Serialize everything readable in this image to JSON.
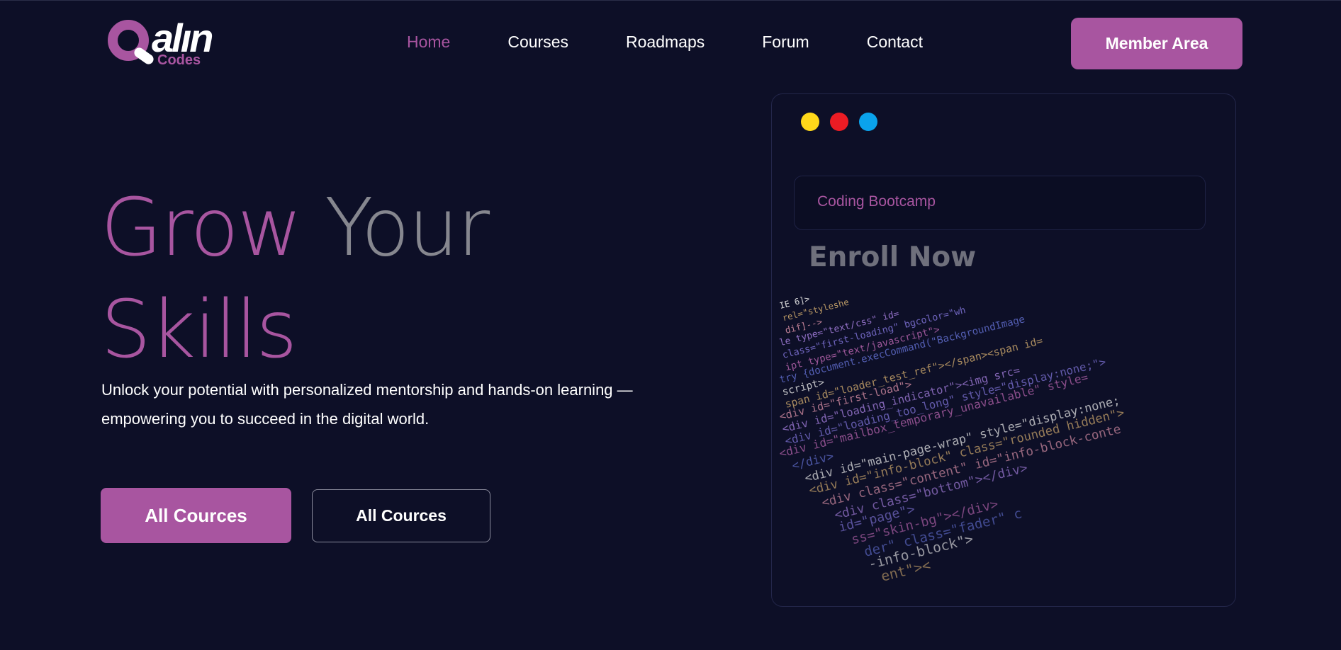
{
  "brand": {
    "logo_word": "alın",
    "logo_sub": "Codes"
  },
  "nav": {
    "items": [
      {
        "label": "Home",
        "active": true
      },
      {
        "label": "Courses",
        "active": false
      },
      {
        "label": "Roadmaps",
        "active": false
      },
      {
        "label": "Forum",
        "active": false
      },
      {
        "label": "Contact",
        "active": false
      }
    ],
    "member_label": "Member Area"
  },
  "hero": {
    "title_word1": "Grow",
    "title_word2": "Your",
    "title_word3": "Skills",
    "subtitle_line1": "Unlock your potential with personalized mentorship and hands-on learning —",
    "subtitle_line2": "empowering you to succeed in the digital world.",
    "primary_button": "All Cources",
    "secondary_button": "All Cources"
  },
  "card": {
    "tag": "Coding Bootcamp",
    "enroll": "Enroll Now",
    "code_lines": [
      "IE 6]>",
      "rel=\"styleshe",
      "dif]-->",
      "le type=\"text/css\" id=",
      "class=\"first-loading\" bgcolor=\"wh",
      "ipt type=\"text/javascript\">",
      "try {document.execCommand(\"BackgroundImage",
      "script>",
      "span id=\"loader_test_ref\"></span><span id=",
      "<div id=\"first-load\">",
      "<div id=\"loading_indicator\"><img src=",
      "<div id=\"loading_too_long\" style=\"display:none;\">",
      "<div id=\"mailbox_temporary_unavailable\" style=",
      "</div>",
      "<div id=\"main-page-wrap\" style=\"display:none;",
      "<div id=\"info-block\" class=\"rounded hidden\">",
      "<div class=\"content\" id=\"info-block-conte",
      "<div class=\"bottom\"></div>",
      "id=\"page\">",
      "ss=\"skin-bg\"></div>",
      "der\" class=\"fader\" c",
      "-info-block\">",
      "ent\"><"
    ]
  },
  "colors": {
    "background": "#0d0f27",
    "accent": "#a855a0",
    "muted_text": "#86878f",
    "dot_yellow": "#ffd81a",
    "dot_red": "#ec1c24",
    "dot_blue": "#0aa3ec"
  }
}
